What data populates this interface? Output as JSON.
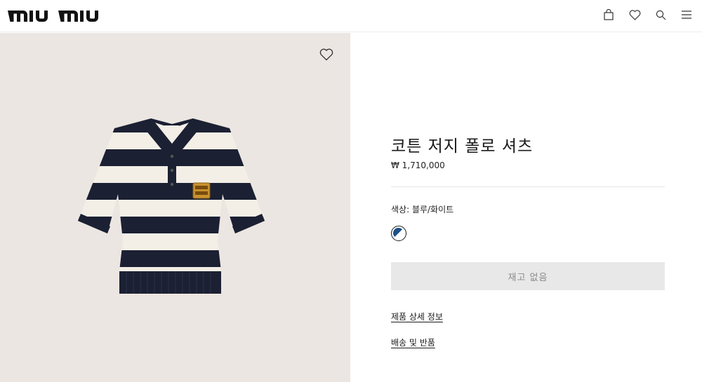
{
  "header": {
    "logo_text": "miu miu",
    "icons": [
      "bag-icon",
      "heart-icon",
      "search-icon",
      "menu-icon"
    ]
  },
  "product": {
    "title": "코튼 저지 폴로 셔츠",
    "price": "₩ 1,710,000",
    "color_label": "색상: 블루/화이트",
    "swatch_colors": [
      "#1d4f86",
      "#ffffff"
    ],
    "button_label": "재고 없음",
    "links": {
      "details": "제품 상세 정보",
      "shipping": "배송 및 반품"
    }
  },
  "colors": {
    "image_background": "#ebe6e1",
    "stripe_navy": "#1b2033",
    "stripe_cream": "#f3efe6",
    "logo_patch": "#c8922e",
    "button_bg": "#e8e8e8"
  }
}
